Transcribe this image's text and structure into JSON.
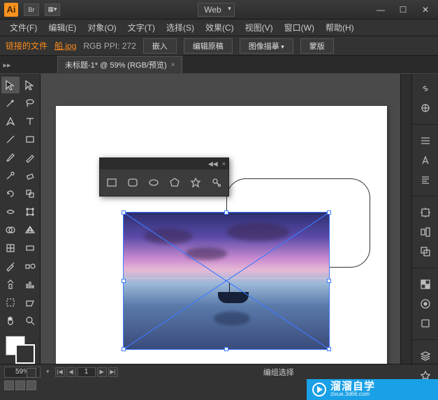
{
  "titlebar": {
    "logo": "Ai",
    "br": "Br",
    "preset": "Web"
  },
  "win": {
    "min": "—",
    "max": "☐",
    "close": "✕"
  },
  "menu": [
    {
      "t": "文件(F)"
    },
    {
      "t": "编辑(E)"
    },
    {
      "t": "对象(O)"
    },
    {
      "t": "文字(T)"
    },
    {
      "t": "选择(S)"
    },
    {
      "t": "效果(C)"
    },
    {
      "t": "视图(V)"
    },
    {
      "t": "窗口(W)"
    },
    {
      "t": "帮助(H)"
    }
  ],
  "ctl": {
    "label": "链接的文件",
    "file": "船.jpg",
    "info": "RGB  PPI: 272",
    "embed": "嵌入",
    "edit_orig": "编辑原稿",
    "trace": "图像描摹",
    "mask": "蒙版"
  },
  "tab": {
    "title": "未标题-1* @ 59% (RGB/预览)",
    "close": "×"
  },
  "status": {
    "zoom": "59%",
    "page": "1",
    "mode": "编组选择"
  },
  "watermark": {
    "brand": "溜溜自学",
    "url": "zixue.3d66.com"
  },
  "shape_panel": {
    "collapse": "◀◀",
    "close": "×"
  }
}
